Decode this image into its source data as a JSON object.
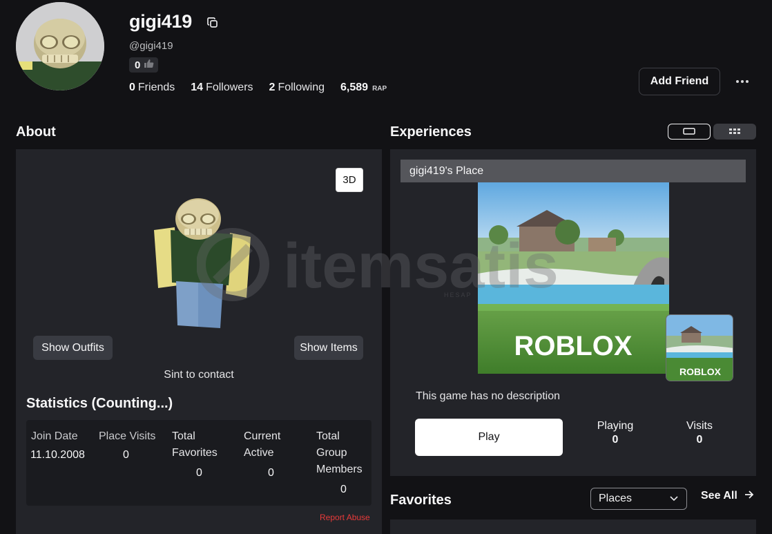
{
  "profile": {
    "username": "gigi419",
    "handle": "@gigi419",
    "badge_count": "0",
    "stats": [
      {
        "value": "0",
        "label": "Friends"
      },
      {
        "value": "14",
        "label": "Followers"
      },
      {
        "value": "2",
        "label": "Following"
      },
      {
        "value": "6,589",
        "label": "RAP"
      }
    ],
    "add_friend_label": "Add Friend"
  },
  "about": {
    "heading": "About",
    "btn_3d": "3D",
    "show_outfits": "Show Outfits",
    "show_items": "Show Items",
    "contact_text": "Sint to contact",
    "statistics_title": "Statistics (Counting...)",
    "statistics": [
      {
        "label": "Join Date",
        "value": "11.10.2008"
      },
      {
        "label": "Place Visits",
        "value": "0"
      },
      {
        "label": "Total Favorites",
        "value": "0"
      },
      {
        "label": "Current Active",
        "value": "0"
      },
      {
        "label": "Total Group Members",
        "value": "0"
      }
    ],
    "report_abuse": "Report Abuse"
  },
  "experiences": {
    "heading": "Experiences",
    "place_name": "gigi419's Place",
    "thumb_logo": "ROBLOX",
    "description": "This game has no description",
    "play_label": "Play",
    "playing_label": "Playing",
    "playing_value": "0",
    "visits_label": "Visits",
    "visits_value": "0"
  },
  "favorites": {
    "heading": "Favorites",
    "filter_selected": "Places",
    "see_all_label": "See All"
  },
  "watermark": {
    "brand": "itemsatis",
    "sub": "HESAP"
  },
  "colors": {
    "background": "#121215",
    "panel": "#232429",
    "report": "#e83a3a",
    "button_light": "#ffffff"
  }
}
